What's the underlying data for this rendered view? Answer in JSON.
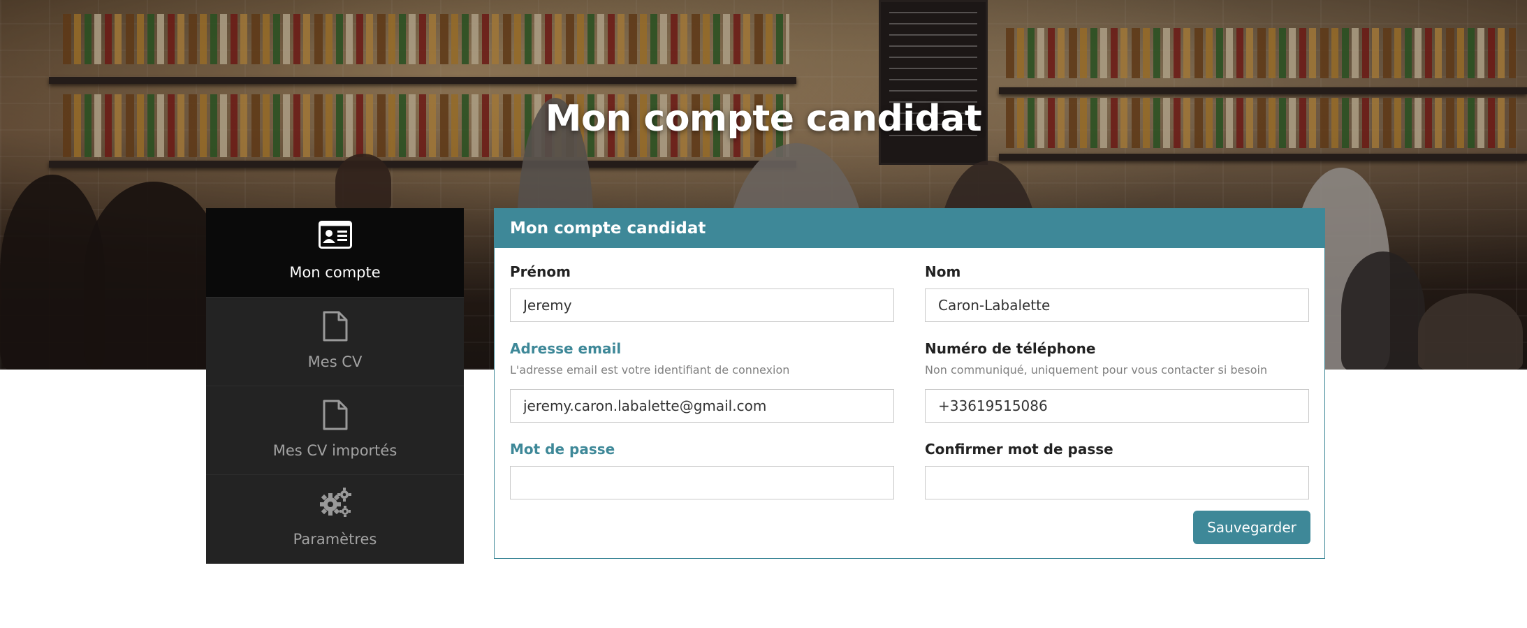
{
  "header": {
    "title": "Mon compte candidat"
  },
  "sidebar": {
    "items": [
      {
        "label": "Mon compte",
        "icon": "id-card-icon",
        "active": true
      },
      {
        "label": "Mes CV",
        "icon": "document-icon",
        "active": false
      },
      {
        "label": "Mes CV importés",
        "icon": "document-icon",
        "active": false
      },
      {
        "label": "Paramètres",
        "icon": "gears-icon",
        "active": false
      }
    ]
  },
  "panel": {
    "title": "Mon compte candidat",
    "firstname": {
      "label": "Prénom",
      "value": "Jeremy"
    },
    "lastname": {
      "label": "Nom",
      "value": "Caron-Labalette"
    },
    "email": {
      "label": "Adresse email",
      "help": "L'adresse email est votre identifiant de connexion",
      "value": "jeremy.caron.labalette@gmail.com"
    },
    "phone": {
      "label": "Numéro de téléphone",
      "help": "Non communiqué, uniquement pour vous contacter si besoin",
      "value": "+33619515086"
    },
    "password": {
      "label": "Mot de passe",
      "value": ""
    },
    "confirm_password": {
      "label": "Confirmer mot de passe",
      "value": ""
    },
    "save_label": "Sauvegarder"
  },
  "colors": {
    "accent": "#3e8898",
    "sidebar_bg": "#232323",
    "sidebar_active_bg": "#0a0a0a"
  }
}
